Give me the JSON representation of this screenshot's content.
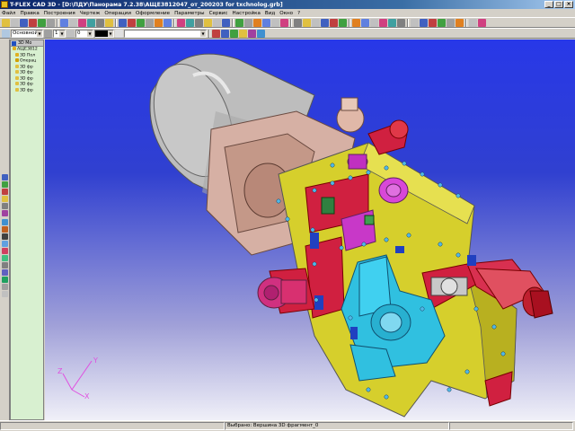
{
  "window": {
    "title": "T-FLEX CAD 3D - [D:\\ПДУ\\Панорама 7.2.38\\АЩЕ3812047_от_200203 for txchnolog.grb]",
    "buttons": [
      "_",
      "□",
      "×"
    ]
  },
  "menu": [
    "Файл",
    "Правка",
    "Построения",
    "Чертеж",
    "Операции",
    "Оформление",
    "Параметры",
    "Сервис",
    "Настройка",
    "Вид",
    "Окно",
    "?"
  ],
  "toolbar2": {
    "layer_value": "Основной",
    "line_value": "1",
    "width_value": "0",
    "color_value": "",
    "style_value": ""
  },
  "tree": {
    "header": "3D Мо",
    "items": [
      {
        "label": "АЩЕ3812",
        "icon_color": "#e0b020"
      },
      {
        "label": "3D Пол",
        "icon_color": "#e0b020"
      },
      {
        "label": "Операц",
        "icon_color": "#d0a000"
      },
      {
        "label": "3D фр",
        "icon_color": "#e0c040"
      },
      {
        "label": "3D фр",
        "icon_color": "#e0c040"
      },
      {
        "label": "3D фр",
        "icon_color": "#e0c040"
      },
      {
        "label": "3D фр",
        "icon_color": "#e0c040"
      },
      {
        "label": "3D фр",
        "icon_color": "#e0c040"
      }
    ]
  },
  "axes": {
    "x": "X",
    "y": "Y",
    "z": "Z"
  },
  "status": {
    "message": "",
    "selection": "Выбрано: Вершина 3D фрагмент_0",
    "extra": ""
  },
  "colors": {
    "titlebar": "#0a246a",
    "viewport_top": "#2838e8",
    "body_yellow": "#d8d030",
    "body_red": "#d82040",
    "body_cyan": "#30c0e0",
    "body_magenta": "#d040d0",
    "body_grey": "#c8c8c8",
    "body_pink": "#e0b0a0"
  }
}
